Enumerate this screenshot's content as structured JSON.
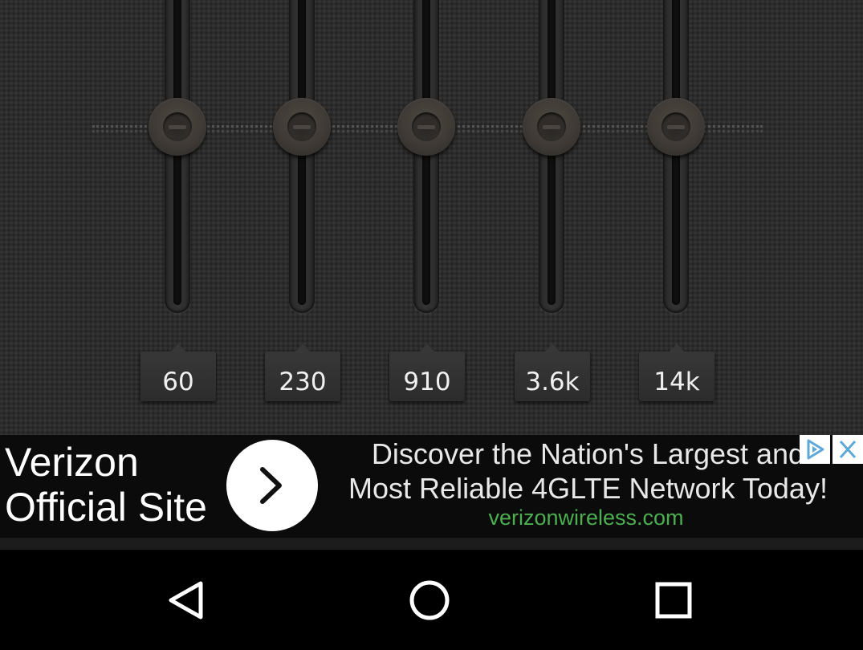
{
  "equalizer": {
    "bands": [
      {
        "label": "60",
        "gain_db": 0
      },
      {
        "label": "230",
        "gain_db": 0
      },
      {
        "label": "910",
        "gain_db": 0
      },
      {
        "label": "3.6k",
        "gain_db": 0
      },
      {
        "label": "14k",
        "gain_db": 0
      }
    ]
  },
  "ad": {
    "title": "Verizon\nOfficial Site",
    "headline": "Discover the Nation's Largest and\nMost Reliable 4GLTE Network Today!",
    "url": "verizonwireless.com",
    "url_color": "#4caf50",
    "arrow_icon": "chevron-right-icon",
    "adchoices_icon": "adchoices-icon",
    "close_icon": "close-icon"
  },
  "nav": {
    "back_icon": "back-triangle-icon",
    "home_icon": "home-circle-icon",
    "recents_icon": "recents-square-icon"
  }
}
